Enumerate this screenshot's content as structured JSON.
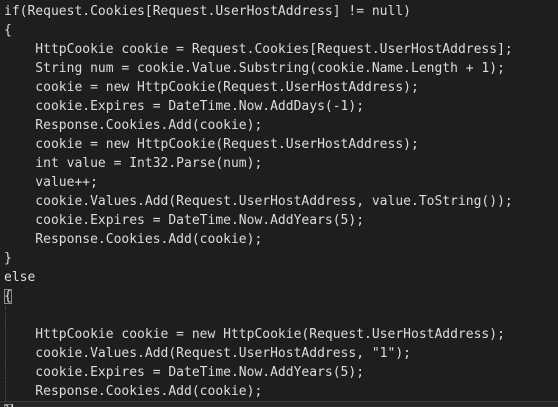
{
  "code": {
    "lines": [
      "if(Request.Cookies[Request.UserHostAddress] != null)",
      "{",
      "    HttpCookie cookie = Request.Cookies[Request.UserHostAddress];",
      "    String num = cookie.Value.Substring(cookie.Name.Length + 1);",
      "    cookie = new HttpCookie(Request.UserHostAddress);",
      "    cookie.Expires = DateTime.Now.AddDays(-1);",
      "    Response.Cookies.Add(cookie);",
      "    cookie = new HttpCookie(Request.UserHostAddress);",
      "    int value = Int32.Parse(num);",
      "    value++;",
      "    cookie.Values.Add(Request.UserHostAddress, value.ToString());",
      "    cookie.Expires = DateTime.Now.AddYears(5);",
      "    Response.Cookies.Add(cookie);",
      "}",
      "else",
      "{",
      "",
      "    HttpCookie cookie = new HttpCookie(Request.UserHostAddress);",
      "    cookie.Values.Add(Request.UserHostAddress, \"1\");",
      "    cookie.Expires = DateTime.Now.AddYears(5);",
      "    Response.Cookies.Add(cookie);",
      "}"
    ]
  },
  "theme": {
    "background": "#1e1e1e",
    "text": "#dcdcdc",
    "current_line": "#262626",
    "indent_guide": "#555555"
  }
}
